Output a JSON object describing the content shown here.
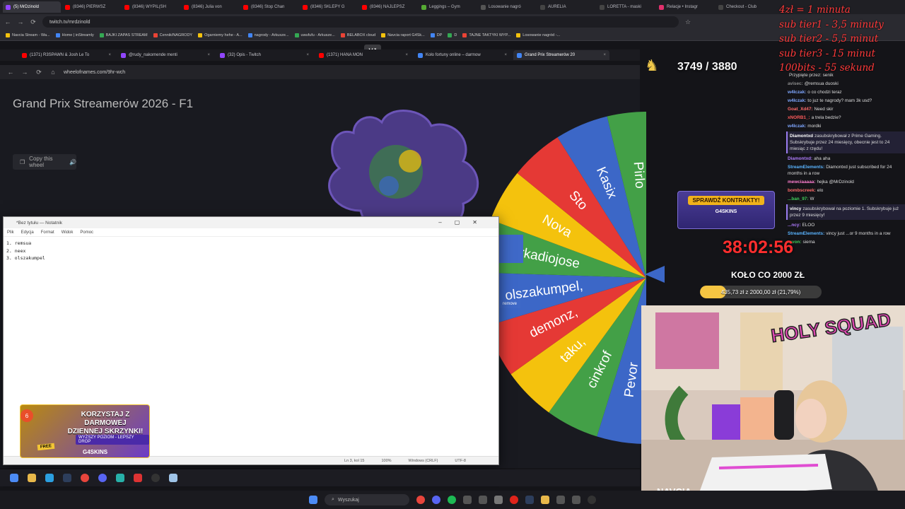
{
  "outer_tabs": [
    {
      "label": "(5) MrDzinold",
      "color": "#9146ff",
      "active": true
    },
    {
      "label": "(8346) PIERWSZ",
      "color": "#ff0000"
    },
    {
      "label": "(8346) WYPIL(SH",
      "color": "#ff0000"
    },
    {
      "label": "(8346) Julia von",
      "color": "#ff0000"
    },
    {
      "label": "(8346) Stop Chan",
      "color": "#ff0000"
    },
    {
      "label": "(8346) SKLEPY G",
      "color": "#ff0000"
    },
    {
      "label": "(8346) NAJLEPSZ",
      "color": "#ff0000"
    },
    {
      "label": "Leggings – Gym",
      "color": "#55aa33"
    },
    {
      "label": "Losowanie nagró",
      "color": "#555555"
    },
    {
      "label": "AURELIA",
      "color": "#444444"
    },
    {
      "label": "LORETTA - maski",
      "color": "#444444"
    },
    {
      "label": "Relacje • Instagr",
      "color": "#e1306c"
    },
    {
      "label": "Checkout - Club",
      "color": "#444444"
    }
  ],
  "outer_url": "twitch.tv/mrdzinold",
  "bookmarks": [
    "Navcia Stream - Wa...",
    "Home | inStreamly",
    "BAJKI ZAPAS STREAM",
    "Cennik/NAGRODY",
    "Ogarniemy hehe - A...",
    "nagrody - Arkusze...",
    "uwufufu - Arkusze...",
    "BELABOX cloud",
    "Navcia raport G4Sk...",
    "DP",
    "D",
    "TAJNE TAKTYKI WYP...",
    "Losowanie nagród -..."
  ],
  "overlay_note": [
    "4zł = 1 minuta",
    "sub tier1 - 3,5 minuty",
    "sub tier2 - 5,5 minut",
    "sub tier3 - 15 minut",
    "100bits - 55 sekund"
  ],
  "inner_tabs": [
    {
      "label": "(1371) R3SPAWN & Josh Le To",
      "color": "#ff0000"
    },
    {
      "label": "@rudy_nakomende menti",
      "color": "#9146ff"
    },
    {
      "label": "(32) Opis - Twitch",
      "color": "#9146ff"
    },
    {
      "label": "(1371) HANA MON",
      "color": "#ff0000"
    },
    {
      "label": "Koło fortuny online – darmow",
      "color": "#4285f4"
    },
    {
      "label": "Grand Prix Streamerów 20",
      "color": "#4285f4",
      "active": true
    }
  ],
  "vj_label": "VJ",
  "inner_url": "wheelofnames.com/9hr-wch",
  "wheel_title": "Grand Prix Streamerów 2026 - F1",
  "copy_wheel": "Copy this wheel",
  "remove_label": "remove",
  "wheel_entries": [
    {
      "label": "",
      "color": "#e53935"
    },
    {
      "label": "Pevor",
      "color": "#3c67c7"
    },
    {
      "label": "cinkrof",
      "color": "#43a047"
    },
    {
      "label": "taku,",
      "color": "#f4c20d"
    },
    {
      "label": "demonz,",
      "color": "#e53935"
    },
    {
      "label": "olszakumpel,",
      "color": "#3c67c7"
    },
    {
      "label": "Arkadiojose",
      "color": "#43a047"
    },
    {
      "label": "Nova",
      "color": "#f4c20d"
    },
    {
      "label": "Sto",
      "color": "#e53935"
    },
    {
      "label": "Kasix",
      "color": "#3c67c7"
    },
    {
      "label": "Pirlo",
      "color": "#43a047"
    }
  ],
  "notepad": {
    "title": "*Bez tytułu — Notatnik",
    "menu": [
      "Plik",
      "Edycja",
      "Format",
      "Widok",
      "Pomoc"
    ],
    "lines": [
      "1. remsua",
      "2. neex",
      "3. olszakumpel"
    ],
    "status": [
      "Ln 3, kol 15",
      "100%",
      "Windows (CRLF)",
      "UTF-8"
    ]
  },
  "counter": "3749 / 3880",
  "kontrakty": {
    "button": "SPRAWDŹ KONTRAKTY!",
    "brand": "G4SKINS"
  },
  "timer": "38:02:56",
  "kolo": "KOŁO CO 2000 ZŁ",
  "progress": {
    "text": "435,73 zł z 2000,00 zł (21,79%)",
    "fraction": 0.2179
  },
  "chat": [
    {
      "user": "",
      "text": "Przypięte przez: senik",
      "color": "#aaaaaa"
    },
    {
      "user": "avisec:",
      "text": "@remsua duoski",
      "color": "#8c8c8c"
    },
    {
      "user": "w4lczak:",
      "text": "o co chodzi teraz",
      "color": "#7fa7ff"
    },
    {
      "user": "w4lczak:",
      "text": "to juz te nagrody? mam 3k usd?",
      "color": "#7fa7ff"
    },
    {
      "user": "Goat_Xd47:",
      "text": "Need skir",
      "color": "#ff6b6b"
    },
    {
      "user": "xNORB1_:",
      "text": "a trela bedzie?",
      "color": "#ff5b5b"
    },
    {
      "user": "w4lczak:",
      "text": "mordki",
      "color": "#7fa7ff"
    },
    {
      "user": "Diamontxd",
      "text": "zasubskrybował z Prime Gaming. Subskrybuje przez 24 miesięcy, obecnie jest to 24 miesiąc z rzędu!",
      "color": "#ffffff",
      "sub": true
    },
    {
      "user": "Diamontxd:",
      "text": "aha aha",
      "color": "#b07cff"
    },
    {
      "user": "StreamElements:",
      "text": "Diamontxd just subscribed for 24 months in a row",
      "color": "#5ab4ff"
    },
    {
      "user": "mewciaaaaa:",
      "text": "hejka @MrDzinold",
      "color": "#ff7fd0"
    },
    {
      "user": "bombscreek:",
      "text": "elo",
      "color": "#ff6b6b"
    },
    {
      "user": "...ban_97:",
      "text": "W",
      "color": "#3fcf5a"
    },
    {
      "user": "vincy",
      "text": "zasubskrybował na poziomie 1. Subskrybuje już przez 9 miesięcy!",
      "color": "#ffffff",
      "sub": true
    },
    {
      "user": "...ncy:",
      "text": "ELOO",
      "color": "#b07cff"
    },
    {
      "user": "StreamElements:",
      "text": "vincy just ...or 9 months in a row",
      "color": "#5ab4ff"
    },
    {
      "user": "revon:",
      "text": "siema",
      "color": "#3fcf5a"
    }
  ],
  "cam_logo": "HOLY SQUAD",
  "cam_tag": "NAVCIA",
  "promo": {
    "line1": "KORZYSTAJ Z DARMOWEJ",
    "line2": "DZIENNEJ SKRZYNKI!",
    "line3": "WYŻSZY POZIOM - LEPSZY DROP",
    "free": "FREE",
    "brand": "G4SKINS",
    "badge": "6"
  },
  "taskbar_search": "Wyszukaj"
}
